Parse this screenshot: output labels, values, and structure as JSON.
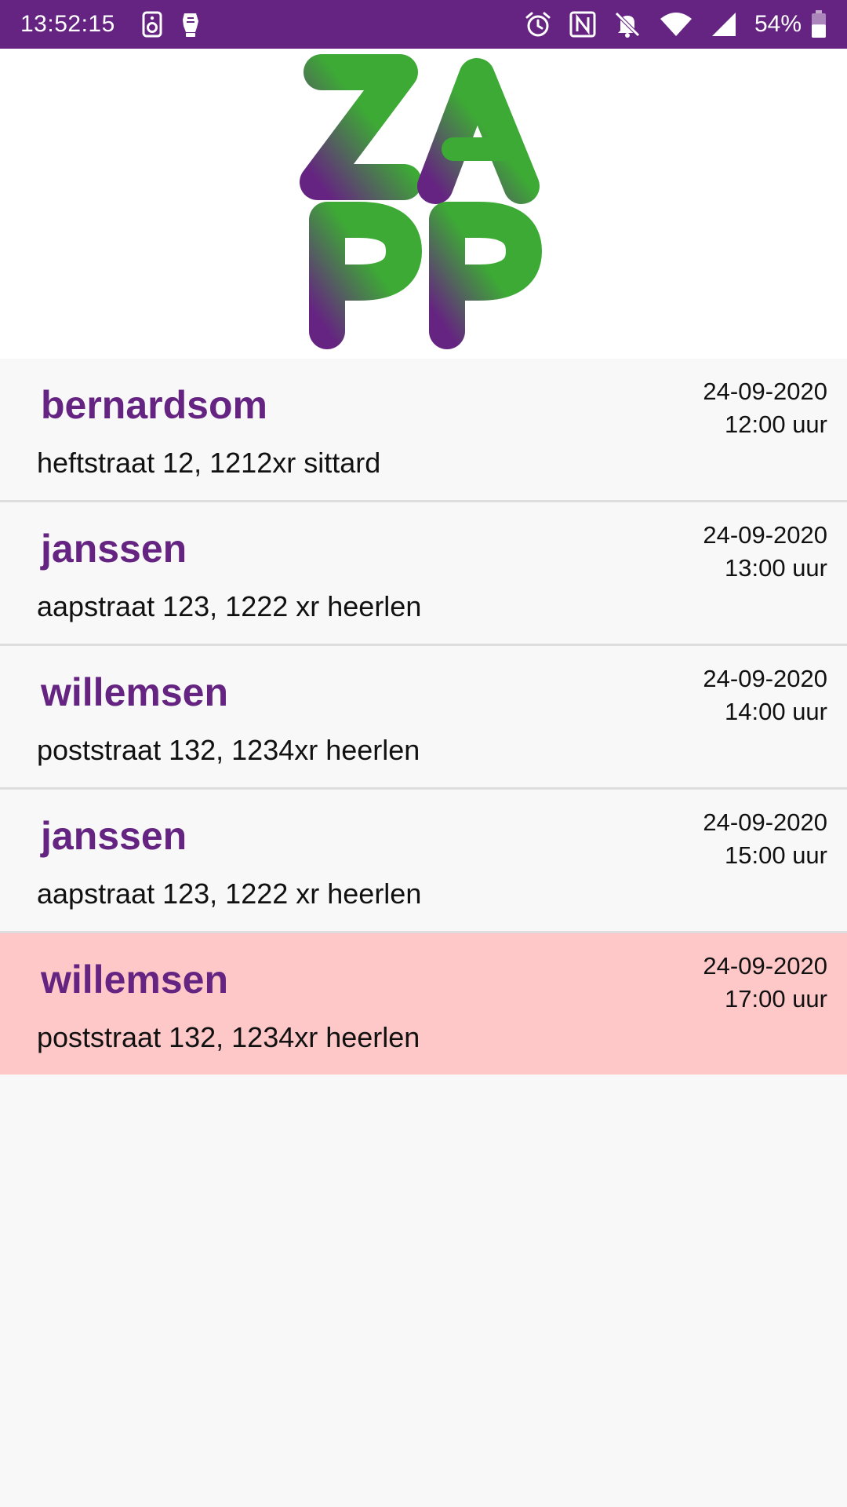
{
  "status_bar": {
    "time": "13:52:15",
    "battery_percent": "54%",
    "battery_level": 0.54,
    "background_color": "#652481",
    "icons_left": [
      "speaker-icon",
      "notification-hand-icon"
    ],
    "icons_right": [
      "alarm-icon",
      "nfc-icon",
      "bell-muted-icon",
      "wifi-icon",
      "signal-icon",
      "battery-icon"
    ]
  },
  "header": {
    "logo_text": "ZAPP",
    "logo_colors": [
      "#652481",
      "#3daa35"
    ]
  },
  "colors": {
    "accent": "#652481",
    "highlight": "#fec8c9",
    "divider": "#dedede"
  },
  "appointments": [
    {
      "name": "bernardsom",
      "address": "heftstraat 12, 1212xr sittard",
      "date": "24-09-2020",
      "time": "12:00 uur",
      "highlighted": false
    },
    {
      "name": "janssen",
      "address": "aapstraat 123, 1222 xr heerlen",
      "date": "24-09-2020",
      "time": "13:00 uur",
      "highlighted": false
    },
    {
      "name": "willemsen",
      "address": "poststraat 132, 1234xr heerlen",
      "date": "24-09-2020",
      "time": "14:00 uur",
      "highlighted": false
    },
    {
      "name": "janssen",
      "address": "aapstraat 123, 1222 xr heerlen",
      "date": "24-09-2020",
      "time": "15:00 uur",
      "highlighted": false
    },
    {
      "name": "willemsen",
      "address": "poststraat 132, 1234xr heerlen",
      "date": "24-09-2020",
      "time": "17:00 uur",
      "highlighted": true
    }
  ]
}
